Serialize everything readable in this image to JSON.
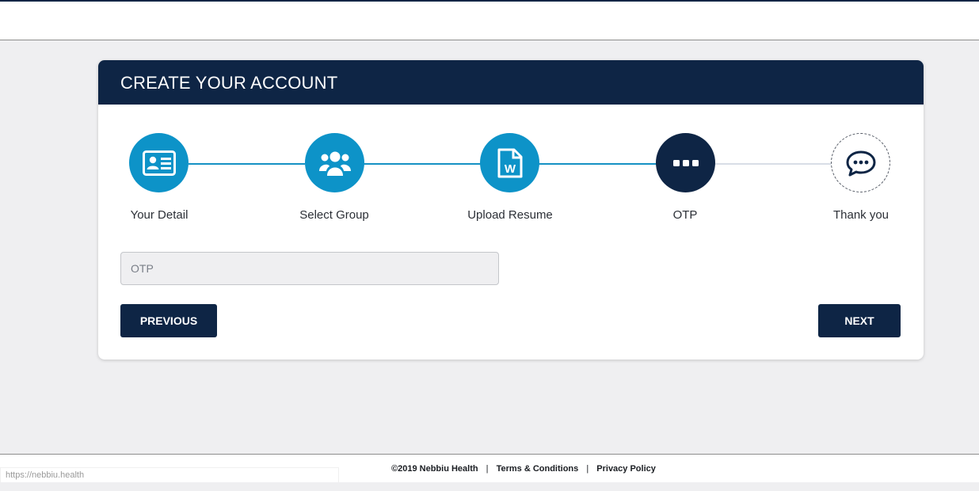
{
  "header": {
    "title": "CREATE YOUR ACCOUNT"
  },
  "steps": [
    {
      "label": "Your Detail",
      "icon": "id-card-icon",
      "state": "done"
    },
    {
      "label": "Select Group",
      "icon": "users-group-icon",
      "state": "done"
    },
    {
      "label": "Upload Resume",
      "icon": "word-document-icon",
      "state": "done"
    },
    {
      "label": "OTP",
      "icon": "dots-icon",
      "state": "active"
    },
    {
      "label": "Thank you",
      "icon": "chat-bubble-icon",
      "state": "todo"
    }
  ],
  "form": {
    "otp_placeholder": "OTP",
    "otp_value": ""
  },
  "buttons": {
    "previous": "PREVIOUS",
    "next": "NEXT"
  },
  "footer": {
    "copyright": "©2019 Nebbiu Health",
    "separator": "|",
    "terms": "Terms & Conditions",
    "privacy": "Privacy Policy"
  },
  "status_bar": {
    "url": "https://nebbiu.health"
  },
  "colors": {
    "navy": "#0e2545",
    "step_blue": "#0d93c8",
    "line_done": "#1691c4",
    "line_todo": "#d8dee6",
    "background": "#efeff1"
  }
}
